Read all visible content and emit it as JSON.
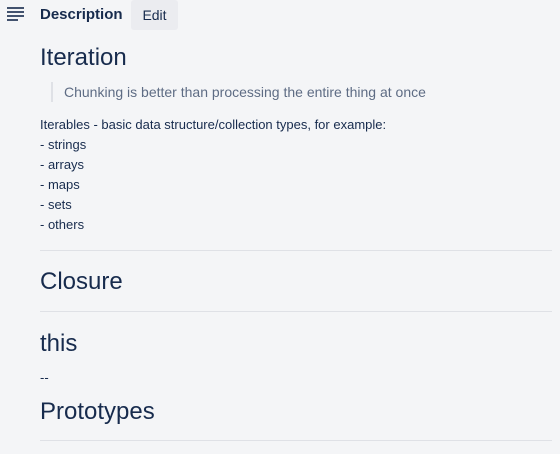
{
  "header": {
    "title": "Description",
    "edit_label": "Edit",
    "icon": "description-icon"
  },
  "sections": {
    "iteration": {
      "heading": "Iteration",
      "quote": "Chunking is better than processing the entire thing at once",
      "intro": "Iterables - basic data structure/collection types, for example:",
      "items": [
        "- strings",
        "- arrays",
        "- maps",
        "- sets",
        "- others"
      ]
    },
    "closure": {
      "heading": "Closure"
    },
    "this": {
      "heading": "this",
      "body": "--"
    },
    "prototypes": {
      "heading": "Prototypes"
    }
  },
  "colors": {
    "background": "#f4f5f7",
    "text": "#172b4d",
    "muted": "#5e6c84",
    "rule": "#dfe1e6",
    "button": "#ebecf0"
  }
}
